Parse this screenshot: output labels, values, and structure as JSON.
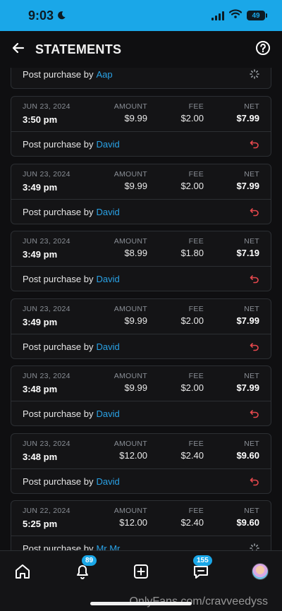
{
  "status_bar": {
    "time": "9:03",
    "battery": "49"
  },
  "header": {
    "title": "STATEMENTS"
  },
  "labels": {
    "amount": "AMOUNT",
    "fee": "FEE",
    "net": "NET",
    "post_purchase_by": "Post purchase by"
  },
  "partial_card": {
    "user": "Aap",
    "status_icon": "pending-icon"
  },
  "cards": [
    {
      "date": "JUN 23, 2024",
      "time": "3:50 pm",
      "amount": "$9.99",
      "fee": "$2.00",
      "net": "$7.99",
      "user": "David",
      "status_icon": "refund-icon"
    },
    {
      "date": "JUN 23, 2024",
      "time": "3:49 pm",
      "amount": "$9.99",
      "fee": "$2.00",
      "net": "$7.99",
      "user": "David",
      "status_icon": "refund-icon"
    },
    {
      "date": "JUN 23, 2024",
      "time": "3:49 pm",
      "amount": "$8.99",
      "fee": "$1.80",
      "net": "$7.19",
      "user": "David",
      "status_icon": "refund-icon"
    },
    {
      "date": "JUN 23, 2024",
      "time": "3:49 pm",
      "amount": "$9.99",
      "fee": "$2.00",
      "net": "$7.99",
      "user": "David",
      "status_icon": "refund-icon"
    },
    {
      "date": "JUN 23, 2024",
      "time": "3:48 pm",
      "amount": "$9.99",
      "fee": "$2.00",
      "net": "$7.99",
      "user": "David",
      "status_icon": "refund-icon"
    },
    {
      "date": "JUN 23, 2024",
      "time": "3:48 pm",
      "amount": "$12.00",
      "fee": "$2.40",
      "net": "$9.60",
      "user": "David",
      "status_icon": "refund-icon"
    },
    {
      "date": "JUN 22, 2024",
      "time": "5:25 pm",
      "amount": "$12.00",
      "fee": "$2.40",
      "net": "$9.60",
      "user": "Mr Mr",
      "status_icon": "pending-icon"
    }
  ],
  "bottom_nav": {
    "notifications_badge": "89",
    "messages_badge": "155"
  },
  "watermark": "OnlyFans.com/cravveedyss",
  "colors": {
    "accent": "#1aa7e8",
    "link": "#2aa2e6",
    "refund": "#e5484d"
  }
}
